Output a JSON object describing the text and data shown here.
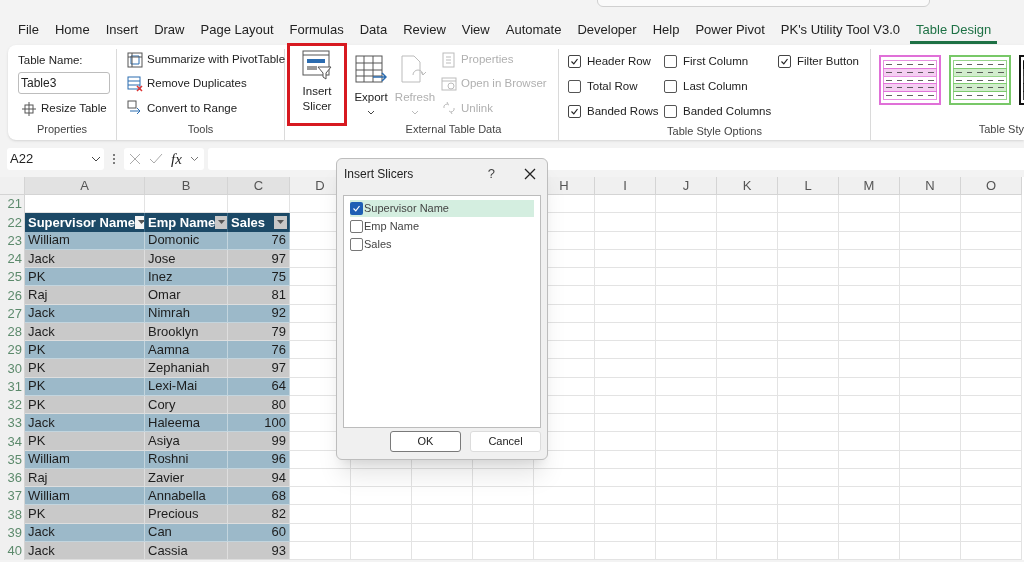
{
  "tabs": [
    {
      "label": "File",
      "selected": false
    },
    {
      "label": "Home",
      "selected": false
    },
    {
      "label": "Insert",
      "selected": false
    },
    {
      "label": "Draw",
      "selected": false
    },
    {
      "label": "Page Layout",
      "selected": false
    },
    {
      "label": "Formulas",
      "selected": false
    },
    {
      "label": "Data",
      "selected": false
    },
    {
      "label": "Review",
      "selected": false
    },
    {
      "label": "View",
      "selected": false
    },
    {
      "label": "Automate",
      "selected": false
    },
    {
      "label": "Developer",
      "selected": false
    },
    {
      "label": "Help",
      "selected": false
    },
    {
      "label": "Power Pivot",
      "selected": false
    },
    {
      "label": "PK's Utility Tool V3.0",
      "selected": false
    },
    {
      "label": "Table Design",
      "selected": true
    }
  ],
  "ribbon": {
    "properties": {
      "label": "Table Name:",
      "value": "Table3",
      "resize": "Resize Table",
      "caption": "Properties"
    },
    "tools": {
      "items": [
        {
          "kind": "pivot",
          "label": "Summarize with PivotTable"
        },
        {
          "kind": "duplicates",
          "label": "Remove Duplicates"
        },
        {
          "kind": "convert",
          "label": "Convert to Range"
        }
      ],
      "caption": "Tools"
    },
    "insert_slicer": {
      "label": "Insert Slicer",
      "highlighted": true
    },
    "external": {
      "large": [
        {
          "kind": "export",
          "label": "Export",
          "disabled": false
        },
        {
          "kind": "refresh",
          "label": "Refresh",
          "disabled": true
        }
      ],
      "items": [
        {
          "kind": "properties",
          "label": "Properties",
          "disabled": true
        },
        {
          "kind": "browser",
          "label": "Open in Browser",
          "disabled": true
        },
        {
          "kind": "unlink",
          "label": "Unlink",
          "disabled": true
        }
      ],
      "caption": "External Table Data"
    },
    "style_options": {
      "options": [
        {
          "label": "Header Row",
          "checked": true
        },
        {
          "label": "Total Row",
          "checked": false
        },
        {
          "label": "Banded Rows",
          "checked": true
        },
        {
          "label": "First Column",
          "checked": false
        },
        {
          "label": "Last Column",
          "checked": false
        },
        {
          "label": "Banded Columns",
          "checked": false
        },
        {
          "label": "Filter Button",
          "checked": true
        }
      ],
      "caption": "Table Style Options"
    },
    "table_styles": {
      "swatches": [
        {
          "color": "#e070d8"
        },
        {
          "color": "#78c868"
        },
        {
          "color": "#111111"
        }
      ],
      "caption": "Table Sty"
    }
  },
  "formula_bar": {
    "name_box": "A22",
    "function_label": "fx"
  },
  "sheet": {
    "columns": [
      "A",
      "B",
      "C",
      "D",
      "H",
      "I",
      "J",
      "K",
      "L",
      "M",
      "N",
      "O"
    ],
    "row_numbers": [
      "21",
      "22",
      "23",
      "24",
      "25",
      "26",
      "27",
      "28",
      "29",
      "30",
      "31",
      "32",
      "33",
      "34",
      "35",
      "36",
      "37",
      "38",
      "39",
      "40"
    ],
    "table": {
      "header": [
        "Supervisor Name",
        "Emp Name",
        "Sales"
      ],
      "rows": [
        [
          "William",
          "Domonic",
          "76"
        ],
        [
          "Jack",
          "Jose",
          "97"
        ],
        [
          "PK",
          "Inez",
          "75"
        ],
        [
          "Raj",
          "Omar",
          "81"
        ],
        [
          "Jack",
          "Nimrah",
          "92"
        ],
        [
          "Jack",
          "Brooklyn",
          "79"
        ],
        [
          "PK",
          "Aamna",
          "76"
        ],
        [
          "PK",
          "Zephaniah",
          "97"
        ],
        [
          "PK",
          "Lexi-Mai",
          "64"
        ],
        [
          "PK",
          "Cory",
          "80"
        ],
        [
          "Jack",
          "Haleema",
          "100"
        ],
        [
          "PK",
          "Asiya",
          "99"
        ],
        [
          "William",
          "Roshni",
          "96"
        ],
        [
          "Raj",
          "Zavier",
          "94"
        ],
        [
          "William",
          "Annabella",
          "68"
        ],
        [
          "PK",
          "Precious",
          "82"
        ],
        [
          "Jack",
          "Can",
          "60"
        ],
        [
          "Jack",
          "Cassia",
          "93"
        ]
      ]
    }
  },
  "dialog": {
    "title": "Insert Slicers",
    "help": "?",
    "fields": [
      {
        "label": "Supervisor Name",
        "checked": true,
        "selected": true
      },
      {
        "label": "Emp Name",
        "checked": false,
        "selected": false
      },
      {
        "label": "Sales",
        "checked": false,
        "selected": false
      }
    ],
    "buttons": [
      {
        "label": "OK",
        "default": true
      },
      {
        "label": "Cancel",
        "default": false
      }
    ]
  }
}
